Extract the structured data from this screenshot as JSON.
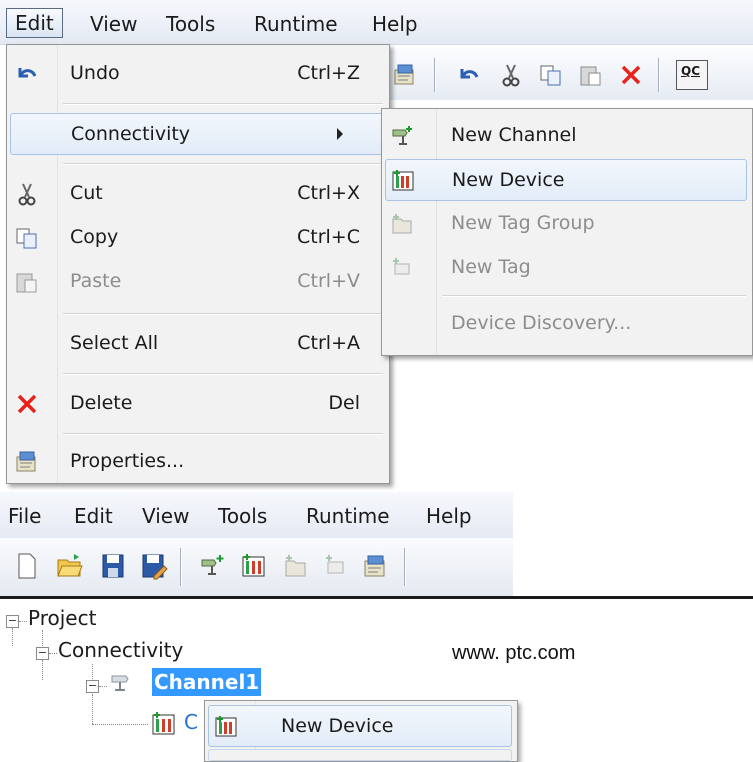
{
  "top_window": {
    "menubar": [
      {
        "label": "Edit",
        "active": true
      },
      {
        "label": "View"
      },
      {
        "label": "Tools"
      },
      {
        "label": "Runtime"
      },
      {
        "label": "Help"
      }
    ],
    "toolbar_icons": [
      "properties-icon",
      "undo-icon",
      "cut-icon",
      "copy-icon",
      "paste-icon",
      "delete-icon",
      "quick-client-icon"
    ],
    "quick_client_badge": "QC"
  },
  "edit_menu": {
    "undo": {
      "label": "Undo",
      "shortcut": "Ctrl+Z"
    },
    "connectivity": {
      "label": "Connectivity"
    },
    "cut": {
      "label": "Cut",
      "shortcut": "Ctrl+X"
    },
    "copy": {
      "label": "Copy",
      "shortcut": "Ctrl+C"
    },
    "paste": {
      "label": "Paste",
      "shortcut": "Ctrl+V"
    },
    "select_all": {
      "label": "Select All",
      "shortcut": "Ctrl+A"
    },
    "delete": {
      "label": "Delete",
      "shortcut": "Del"
    },
    "properties": {
      "label": "Properties..."
    }
  },
  "connectivity_submenu": {
    "new_channel": {
      "label": "New Channel"
    },
    "new_device": {
      "label": "New Device"
    },
    "new_tag_group": {
      "label": "New Tag Group"
    },
    "new_tag": {
      "label": "New Tag"
    },
    "device_discovery": {
      "label": "Device Discovery..."
    }
  },
  "bottom_window": {
    "menubar": [
      "File",
      "Edit",
      "View",
      "Tools",
      "Runtime",
      "Help"
    ],
    "toolbar_icons": [
      "new-icon",
      "open-icon",
      "save-icon",
      "save-as-icon",
      "new-channel-icon",
      "new-device-icon",
      "new-tag-group-icon",
      "new-tag-icon",
      "properties-icon"
    ]
  },
  "project_tree": {
    "root": "Project",
    "connectivity": "Connectivity",
    "channel": "Channel1",
    "device_partial": "C"
  },
  "context_menu": {
    "new_device": {
      "label": "New Device"
    }
  },
  "watermark": "www. ptc.com",
  "colors": {
    "selection": "#3399ff",
    "highlight_border": "#a9c4e6",
    "menu_bg": "#f2f2f2",
    "delete_red": "#e8211b"
  }
}
